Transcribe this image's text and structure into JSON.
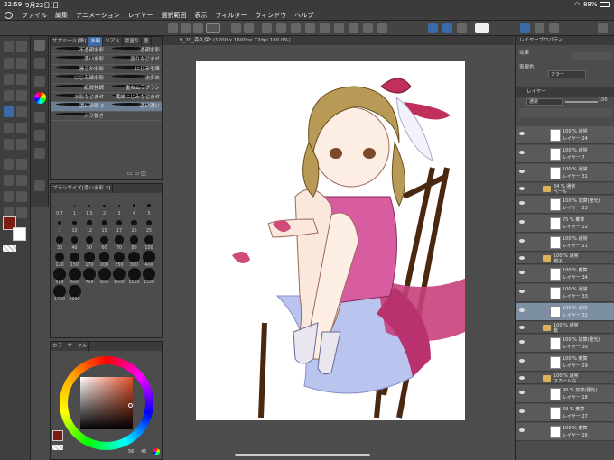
{
  "status": {
    "time": "22:59",
    "date": "9月22日(日)",
    "battery": "88%"
  },
  "menu": [
    "ファイル",
    "編集",
    "アニメーション",
    "レイヤー",
    "選択範囲",
    "表示",
    "フィルター",
    "ウィンドウ",
    "ヘルプ"
  ],
  "document": {
    "tab": "9_20_森久保* (1200 x 1600px 72dpi 100.0%)"
  },
  "brush_panel": {
    "tabs": [
      "サブツール[筆]",
      "水彩",
      "リアル",
      "厚塗り",
      "墨"
    ],
    "rows": [
      [
        "不透明水彩",
        "透明水彩"
      ],
      [
        "濃い水彩",
        "塗りなじませ"
      ],
      [
        "滑らか水彩",
        "にじみ毛筆"
      ],
      [
        "にじみ縁水彩",
        "水多め"
      ],
      [
        "紙質強調",
        "重ねムラブラシ"
      ],
      [
        "水彩なじませ",
        "繊維にじみなじませ"
      ],
      [
        "濃い水彩 2",
        "濃い濃い"
      ],
      [
        "入り抜き",
        ""
      ]
    ]
  },
  "size_panel": {
    "title": "ブラシサイズ[濃い水彩 2]",
    "labels": [
      "0.7",
      "1",
      "1.5",
      "2",
      "3",
      "4",
      "5",
      "7",
      "10",
      "12",
      "15",
      "17",
      "20",
      "25",
      "30",
      "40",
      "50",
      "60",
      "70",
      "80",
      "100",
      "120",
      "150",
      "170",
      "200",
      "250",
      "300",
      "400",
      "500",
      "600",
      "700",
      "800",
      "1000",
      "1200",
      "1500",
      "1700",
      "2000"
    ]
  },
  "color_panel": {
    "title": "カラーサークル",
    "s_value": "56",
    "v_value": "46"
  },
  "right_panel": {
    "title": "レイヤープロパティ",
    "effect_label": "効果",
    "expression_label": "表現色",
    "expression_value": "カラー",
    "layer_title": "レイヤー",
    "blend_mode": "通常",
    "opacity": "100",
    "layers": [
      {
        "mode": "100 % 通常",
        "name": "レイヤー 24",
        "folder": false,
        "selected": false
      },
      {
        "mode": "100 % 通常",
        "name": "レイヤー 7",
        "folder": false,
        "selected": false
      },
      {
        "mode": "100 % 通常",
        "name": "レイヤー 31",
        "folder": false,
        "selected": false
      },
      {
        "mode": "64 % 通常",
        "name": "ベール",
        "folder": true,
        "selected": false
      },
      {
        "mode": "100 % 加算(発光)",
        "name": "レイヤー 23",
        "folder": false,
        "selected": false
      },
      {
        "mode": "75 % 乗算",
        "name": "レイヤー 22",
        "folder": false,
        "selected": false
      },
      {
        "mode": "100 % 通常",
        "name": "レイヤー 21",
        "folder": false,
        "selected": false
      },
      {
        "mode": "100 % 通常",
        "name": "帽子",
        "folder": true,
        "selected": false
      },
      {
        "mode": "100 % 乗算",
        "name": "レイヤー 34",
        "folder": false,
        "selected": false
      },
      {
        "mode": "100 % 通常",
        "name": "レイヤー 33",
        "folder": false,
        "selected": false
      },
      {
        "mode": "100 % 通常",
        "name": "レイヤー 32",
        "folder": false,
        "selected": true
      },
      {
        "mode": "100 % 通常",
        "name": "靴",
        "folder": true,
        "selected": false
      },
      {
        "mode": "100 % 加算(発光)",
        "name": "レイヤー 30",
        "folder": false,
        "selected": false
      },
      {
        "mode": "100 % 乗算",
        "name": "レイヤー 29",
        "folder": false,
        "selected": false
      },
      {
        "mode": "100 % 通常",
        "name": "スカート白",
        "folder": true,
        "selected": false
      },
      {
        "mode": "90 % 加算(発光)",
        "name": "レイヤー 28",
        "folder": false,
        "selected": false
      },
      {
        "mode": "69 % 乗算",
        "name": "レイヤー 27",
        "folder": false,
        "selected": false
      },
      {
        "mode": "100 % 乗算",
        "name": "レイヤー 26",
        "folder": false,
        "selected": false
      }
    ]
  },
  "colors": {
    "main": "#7a1e14",
    "sub": "#ffffff",
    "accent": "#7d8fa3"
  }
}
